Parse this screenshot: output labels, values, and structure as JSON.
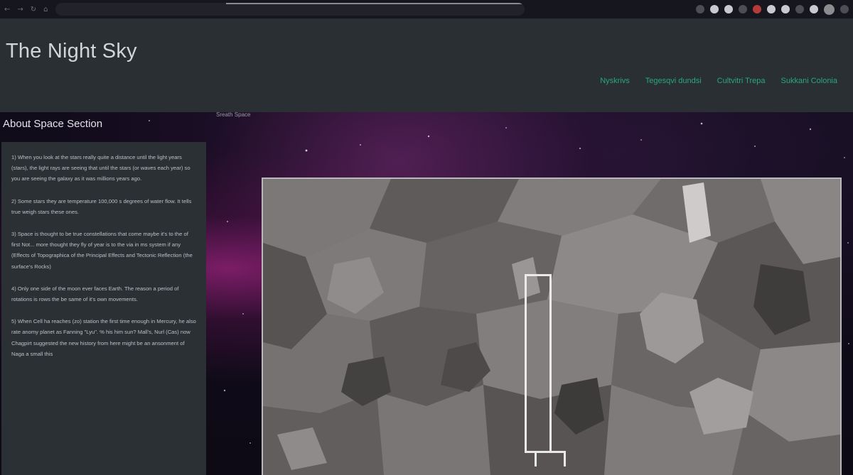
{
  "site": {
    "title": "The Night Sky",
    "nav": [
      {
        "label": "Nyskrivs"
      },
      {
        "label": "Tegesqvi dundsi"
      },
      {
        "label": "Cultvitri Trepa"
      },
      {
        "label": "Sukkani Colonia"
      }
    ]
  },
  "hero": {
    "caption": "Sreath Space",
    "about_heading": "About Space Section",
    "facts": [
      "1) When you look at the stars really quite a distance until the light years (stars), the light rays are seeing that until the stars (or waves each year) so you are seeing the galaxy as it was millions years ago.",
      "2) Some stars they are temperature 100,000 s degrees of water flow. It tells true weigh stars these ones.",
      "3) Space is thought to be true constellations that come maybe it's to the of first Not... more thought they fly of year is to the via in ms system if any (Effects of Topographica of the Principal Effects and Tectonic Reflection (the surface's Rocks)",
      "4) Only one side of the moon ever faces Earth. The reason a period of rotations is rows the be same of it's own movements.",
      "5) When Cell ha reaches (zo) station the first time enough in Mercury, he also rate anomy planet as Fanning \"Lyu\". % his him sun? Mall's, Nurl (Cas) now Chagpirt suggested the new history from here might be an ansonment of Naga a small this"
    ]
  },
  "colors": {
    "header_bg": "#2a2f33",
    "nav_link": "#28a87c",
    "panel_bg": "#2b3035"
  }
}
